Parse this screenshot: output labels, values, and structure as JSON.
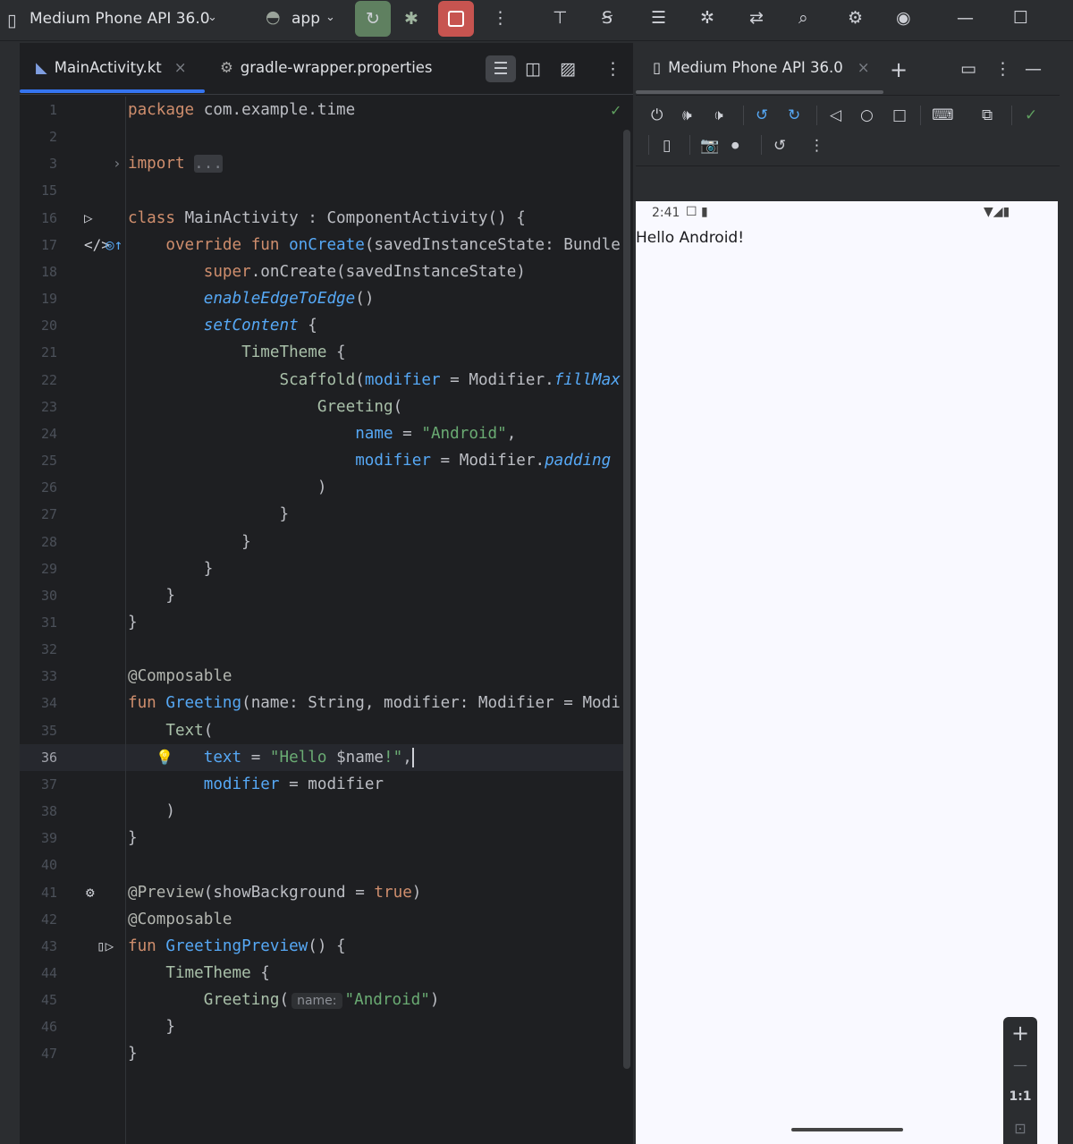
{
  "toolbar": {
    "device": "Medium Phone API 36.0",
    "run_config": "app",
    "icons": [
      "device-icon",
      "android-icon",
      "chevron-down-icon",
      "rerun-icon",
      "debug-icon",
      "stop-icon",
      "more-icon",
      "profiler-icon",
      "translate-icon",
      "layout-inspector-icon",
      "attach-debugger-icon",
      "sync-icon",
      "search-icon",
      "settings-icon",
      "account-icon",
      "minimize-icon",
      "maximize-icon"
    ]
  },
  "editor": {
    "tabs": [
      {
        "label": "MainActivity.kt",
        "active": true
      },
      {
        "label": "gradle-wrapper.properties",
        "active": false
      }
    ],
    "current_line": 36,
    "lines": [
      {
        "n": "1",
        "t": [
          [
            "package ",
            "kw"
          ],
          [
            "com.example.time",
            "tx"
          ]
        ]
      },
      {
        "n": "2",
        "t": []
      },
      {
        "n": "3",
        "t": [
          [
            "import ",
            "kw"
          ],
          [
            "...",
            "fold"
          ]
        ],
        "g": "fold-arrow"
      },
      {
        "n": "15",
        "t": []
      },
      {
        "n": "16",
        "t": [
          [
            "class ",
            "kw"
          ],
          [
            "MainActivity : ComponentActivity() {",
            "tx"
          ]
        ],
        "g": "run-gutter"
      },
      {
        "n": "17",
        "t": [
          [
            "    override fun ",
            "kw"
          ],
          [
            "onCreate",
            "fn"
          ],
          [
            "(savedInstanceState: Bundle",
            "tx"
          ]
        ],
        "g": "override"
      },
      {
        "n": "18",
        "t": [
          [
            "        super",
            "kw"
          ],
          [
            ".onCreate(savedInstanceState)",
            "tx"
          ]
        ]
      },
      {
        "n": "19",
        "t": [
          [
            "        ",
            "tx"
          ],
          [
            "enableEdgeToEdge",
            "ext"
          ],
          [
            "()",
            "tx"
          ]
        ]
      },
      {
        "n": "20",
        "t": [
          [
            "        ",
            "tx"
          ],
          [
            "setContent",
            "ext"
          ],
          [
            " {",
            "tx"
          ]
        ]
      },
      {
        "n": "21",
        "t": [
          [
            "            ",
            "tx"
          ],
          [
            "TimeTheme",
            "cmp"
          ],
          [
            " {",
            "tx"
          ]
        ]
      },
      {
        "n": "22",
        "t": [
          [
            "                ",
            "tx"
          ],
          [
            "Scaffold",
            "cmp"
          ],
          [
            "(",
            "tx"
          ],
          [
            "modifier",
            "arg"
          ],
          [
            " = Modifier.",
            "tx"
          ],
          [
            "fillMax",
            "ext"
          ]
        ]
      },
      {
        "n": "23",
        "t": [
          [
            "                    ",
            "tx"
          ],
          [
            "Greeting",
            "cmp"
          ],
          [
            "(",
            "tx"
          ]
        ]
      },
      {
        "n": "24",
        "t": [
          [
            "                        ",
            "tx"
          ],
          [
            "name",
            "arg"
          ],
          [
            " = ",
            "tx"
          ],
          [
            "\"Android\"",
            "str"
          ],
          [
            ",",
            "tx"
          ]
        ]
      },
      {
        "n": "25",
        "t": [
          [
            "                        ",
            "tx"
          ],
          [
            "modifier",
            "arg"
          ],
          [
            " = Modifier.",
            "tx"
          ],
          [
            "padding",
            "ext"
          ]
        ]
      },
      {
        "n": "26",
        "t": [
          [
            "                    )",
            "tx"
          ]
        ]
      },
      {
        "n": "27",
        "t": [
          [
            "                }",
            "tx"
          ]
        ]
      },
      {
        "n": "28",
        "t": [
          [
            "            }",
            "tx"
          ]
        ]
      },
      {
        "n": "29",
        "t": [
          [
            "        }",
            "tx"
          ]
        ]
      },
      {
        "n": "30",
        "t": [
          [
            "    }",
            "tx"
          ]
        ]
      },
      {
        "n": "31",
        "t": [
          [
            "}",
            "tx"
          ]
        ]
      },
      {
        "n": "32",
        "t": []
      },
      {
        "n": "33",
        "t": [
          [
            "@Composable",
            "ann"
          ]
        ]
      },
      {
        "n": "34",
        "t": [
          [
            "fun ",
            "kw"
          ],
          [
            "Greeting",
            "fn"
          ],
          [
            "(name: String, modifier: Modifier = Modi",
            "tx"
          ]
        ]
      },
      {
        "n": "35",
        "t": [
          [
            "    ",
            "tx"
          ],
          [
            "Text",
            "cmp"
          ],
          [
            "(",
            "tx"
          ]
        ]
      },
      {
        "n": "36",
        "t": [
          [
            "        ",
            "tx"
          ],
          [
            "text",
            "arg"
          ],
          [
            " = ",
            "tx"
          ],
          [
            "\"Hello ",
            "str"
          ],
          [
            "$name",
            "tx"
          ],
          [
            "!\"",
            "str"
          ],
          [
            ",",
            "tx"
          ]
        ],
        "g": "bulb",
        "caret": true
      },
      {
        "n": "37",
        "t": [
          [
            "        ",
            "tx"
          ],
          [
            "modifier",
            "arg"
          ],
          [
            " = modifier",
            "tx"
          ]
        ]
      },
      {
        "n": "38",
        "t": [
          [
            "    )",
            "tx"
          ]
        ]
      },
      {
        "n": "39",
        "t": [
          [
            "}",
            "tx"
          ]
        ]
      },
      {
        "n": "40",
        "t": []
      },
      {
        "n": "41",
        "t": [
          [
            "@Preview",
            "ann"
          ],
          [
            "(showBackground = ",
            "tx"
          ],
          [
            "true",
            "kw"
          ],
          [
            ")",
            "tx"
          ]
        ],
        "g": "gear"
      },
      {
        "n": "42",
        "t": [
          [
            "@Composable",
            "ann"
          ]
        ]
      },
      {
        "n": "43",
        "t": [
          [
            "fun ",
            "kw"
          ],
          [
            "GreetingPreview",
            "fn"
          ],
          [
            "() {",
            "tx"
          ]
        ],
        "g": "preview"
      },
      {
        "n": "44",
        "t": [
          [
            "    ",
            "tx"
          ],
          [
            "TimeTheme",
            "cmp"
          ],
          [
            " {",
            "tx"
          ]
        ]
      },
      {
        "n": "45",
        "t": [
          [
            "        ",
            "tx"
          ],
          [
            "Greeting",
            "cmp"
          ],
          [
            "(",
            "tx"
          ],
          [
            "name:",
            "hint"
          ],
          [
            "\"Android\"",
            "str"
          ],
          [
            ")",
            "tx"
          ]
        ]
      },
      {
        "n": "46",
        "t": [
          [
            "    }",
            "tx"
          ]
        ]
      },
      {
        "n": "47",
        "t": [
          [
            "}",
            "tx"
          ]
        ]
      }
    ]
  },
  "running_devices": {
    "tab_label": "Medium Phone API 36.0",
    "status_time": "2:41",
    "app_text": "Hello Android!",
    "zoom": {
      "plus": "+",
      "minus": "—",
      "actual": "1:1"
    }
  },
  "colors": {
    "accent": "#3574f0",
    "run": "#5f8060",
    "stop": "#c75450",
    "keyword": "#cf8e6d",
    "function": "#56a8f5",
    "string": "#6aab73"
  }
}
